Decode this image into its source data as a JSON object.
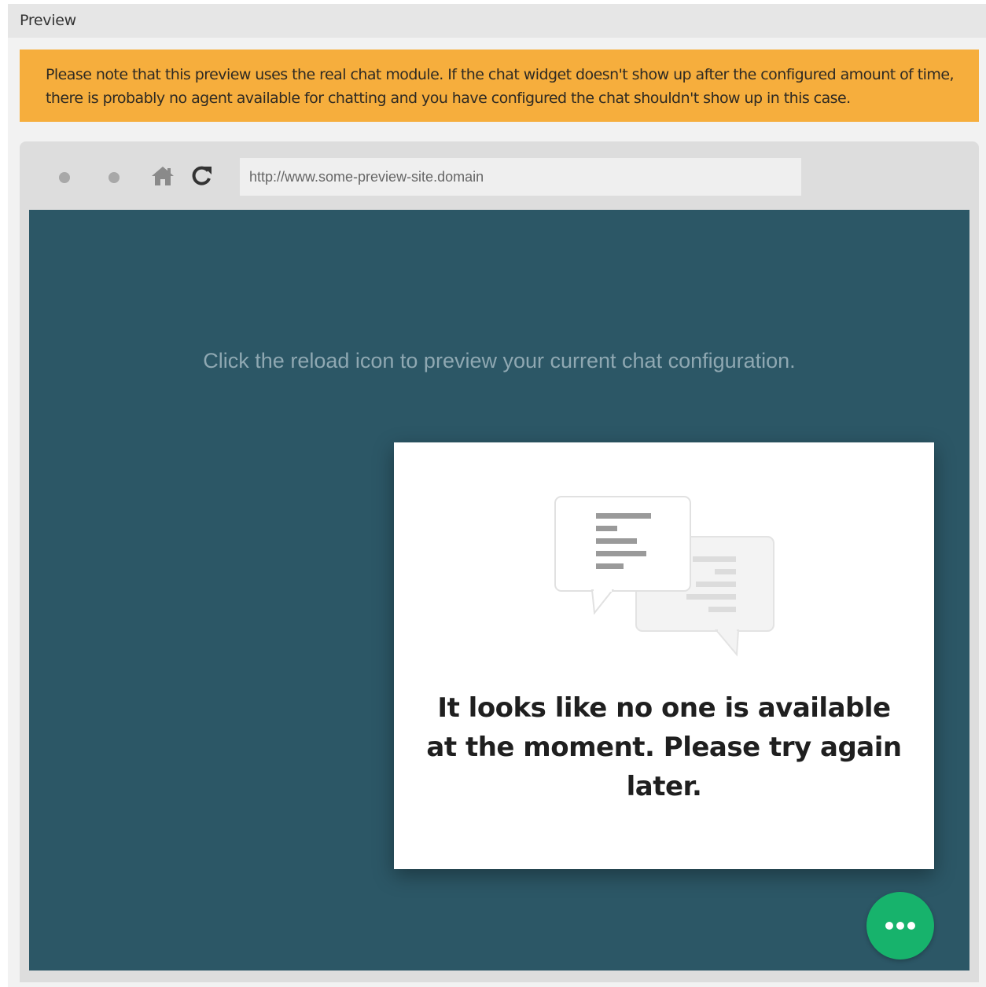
{
  "header": {
    "title": "Preview"
  },
  "notice": {
    "text": "Please note that this preview uses the real chat module. If the chat widget doesn't show up after the configured amount of time, there is probably no agent available for chatting and you have configured the chat shouldn't show up in this case."
  },
  "browser": {
    "url": "http://www.some-preview-site.domain",
    "toolbar_icons": [
      "dot-icon",
      "dot-icon",
      "home-icon",
      "reload-icon"
    ]
  },
  "viewport": {
    "hint": "Click the reload icon to preview your current chat configuration.",
    "background_color": "#2c5766"
  },
  "chat_widget": {
    "illustration_icon": "chat-bubbles-icon",
    "message": "It looks like no one is available at the moment. Please try again later.",
    "fab_icon": "ellipsis-icon",
    "fab_color": "#17b36c"
  },
  "colors": {
    "notice_background": "#f6ae3d",
    "header_background": "#e6e6e6"
  }
}
